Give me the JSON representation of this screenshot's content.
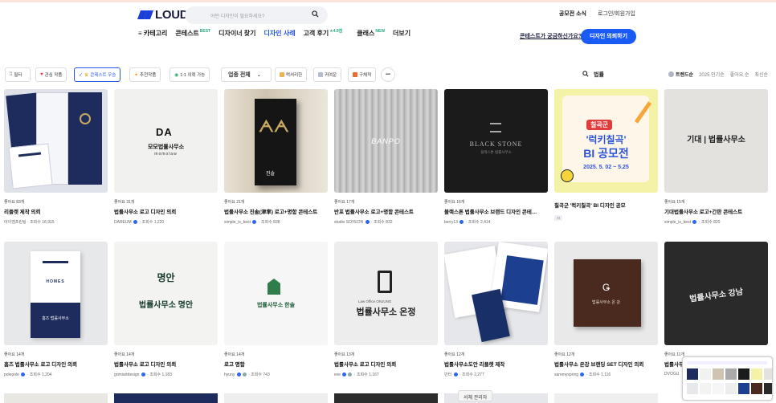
{
  "header": {
    "logo": "LOUD",
    "search_placeholder": "어떤 디자인이 필요하세요?",
    "notice": "공모전 소식",
    "login": "로그인/회원가입",
    "help_link": "콘테스트가 궁금하신가요?",
    "cta": "디자인 의뢰하기"
  },
  "nav": [
    {
      "label": "≡ 카테고리",
      "sup": ""
    },
    {
      "label": "콘테스트",
      "sup": "BEST"
    },
    {
      "label": "디자이너 찾기",
      "sup": ""
    },
    {
      "label": "디자인 사례",
      "sup": "",
      "active": true
    },
    {
      "label": "고객 후기",
      "sup": "★4.9점"
    },
    {
      "label": "클래스",
      "sup": "NEW"
    },
    {
      "label": "더보기",
      "sup": ""
    }
  ],
  "filters": {
    "filter": "필터",
    "favorites": "관심 작품",
    "contest_winner": "콘테스트 우승",
    "recommended": "추천작품",
    "one_on_one": "1:1 의뢰 가능",
    "industry": "업종 전체",
    "tag_luxury": "럭셔리한",
    "tag_cute": "귀여운",
    "tag_concrete": "구체적",
    "search_query": "법률"
  },
  "sort": {
    "trend": "트렌드순",
    "popular_2025": "2025 인기순",
    "likes": "좋아요 순",
    "newest": "최신순"
  },
  "colors": {
    "accent": "#1a5af5",
    "active_nav": "#2554e6"
  },
  "cards": [
    {
      "likes": "좋아요 83개",
      "title": "리플렛 제작 의뢰",
      "author": "아이엠프린팅",
      "verified": false,
      "views": "조회수 18,915"
    },
    {
      "likes": "좋아요 31개",
      "title": "법률사무소 로고 디자인 의뢰",
      "author": "DAREUM",
      "verified": true,
      "views": "조회수 1,220"
    },
    {
      "likes": "좋아요 21개",
      "title": "법률사무소 진솔(津率) 로고+명함 콘테스트",
      "author": "simple_is_best",
      "verified": true,
      "views": "조회수 838"
    },
    {
      "likes": "좋아요 17개",
      "title": "반포 법률사무소 로고+명함 콘테스트",
      "author": "studio SOYEON",
      "verified": true,
      "views": "조회수 832"
    },
    {
      "likes": "좋아요 16개",
      "title": "블랙스톤 법률사무소 브랜드 디자인 콘테…",
      "author": "berry13",
      "verified": true,
      "views": "조회수 2,414"
    },
    {
      "likes": "",
      "title": "칠곡군 '럭키칠곡' BI 디자인 공모",
      "author": "",
      "verified": false,
      "views": "",
      "tag": "AI"
    },
    {
      "likes": "좋아요 15개",
      "title": "기대법률사무소 로고+간판 콘테스트",
      "author": "simple_is_best",
      "verified": true,
      "views": "조회수 820"
    },
    {
      "likes": "좋아요 14개",
      "title": "홈즈 법률사무소 로고 디자인 의뢰",
      "author": "polepole",
      "verified": true,
      "views": "조회수 1,204"
    },
    {
      "likes": "좋아요 14개",
      "title": "법률사무소 로고 디자인 의뢰",
      "author": "grimiartdesign",
      "verified": true,
      "views": "조회수 1,183"
    },
    {
      "likes": "좋아요 14개",
      "title": "로고 명함",
      "author": "hyuny",
      "verified": true,
      "views": "조회수 743"
    },
    {
      "likes": "좋아요 13개",
      "title": "법률사무소 로고 디자인 의뢰",
      "author": "eve",
      "verified": true,
      "views": "조회수 1,167"
    },
    {
      "likes": "좋아요 12개",
      "title": "법률사무소도안 리플렛 제작",
      "author": "민터",
      "verified": true,
      "views": "조회수 2,277"
    },
    {
      "likes": "좋아요 12개",
      "title": "법률사무소 온강 브랜딩 SET 디자인 의뢰",
      "author": "saremyspring",
      "verified": true,
      "views": "조회수 1,116"
    },
    {
      "likes": "좋아요 11개",
      "title": "법률사무",
      "author": "DVOGU",
      "verified": false,
      "views": ""
    }
  ],
  "thumbs": {
    "c2_logo": "DA",
    "c2_name": "모모법률사무소",
    "c2_sub": "momolaw",
    "c3_sign": "진솔",
    "c4_sign": "BANPO",
    "c5_sign": "BLACK STONE",
    "c5_sub": "블랙스톤 법률사무소",
    "c6_top": "칠곡군",
    "c6_l1": "'럭키칠곡'",
    "c6_l2": "BI 공모전",
    "c6_date": "2025. 5. 02 ~ 5.25",
    "c7_sign": "기대 | 법률사무소",
    "c8_brand": "HOMES",
    "c8_name": "홈즈 법률사무소",
    "c9_top": "명안",
    "c9_name": "법률사무소 명안",
    "c10_name": "법률사무소 한솔",
    "c11_small": "Law Office ONJUNG",
    "c11_name": "법률사무소 온정",
    "c13_name": "법률사무소 온 강",
    "c14_name": "법률사무소 강남"
  },
  "floating": {
    "manager": "서체 관리자"
  }
}
